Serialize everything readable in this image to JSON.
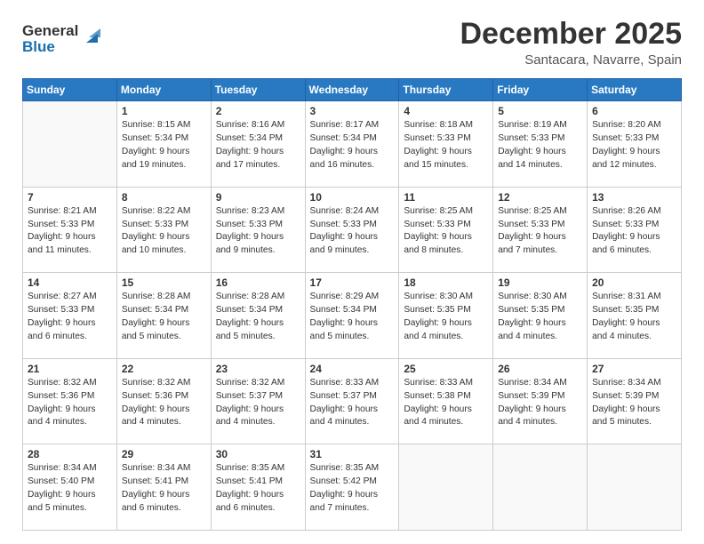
{
  "header": {
    "logo_line1": "General",
    "logo_line2": "Blue",
    "month_title": "December 2025",
    "location": "Santacara, Navarre, Spain"
  },
  "days_of_week": [
    "Sunday",
    "Monday",
    "Tuesday",
    "Wednesday",
    "Thursday",
    "Friday",
    "Saturday"
  ],
  "weeks": [
    [
      {
        "num": "",
        "sunrise": "",
        "sunset": "",
        "daylight": ""
      },
      {
        "num": "1",
        "sunrise": "Sunrise: 8:15 AM",
        "sunset": "Sunset: 5:34 PM",
        "daylight": "Daylight: 9 hours and 19 minutes."
      },
      {
        "num": "2",
        "sunrise": "Sunrise: 8:16 AM",
        "sunset": "Sunset: 5:34 PM",
        "daylight": "Daylight: 9 hours and 17 minutes."
      },
      {
        "num": "3",
        "sunrise": "Sunrise: 8:17 AM",
        "sunset": "Sunset: 5:34 PM",
        "daylight": "Daylight: 9 hours and 16 minutes."
      },
      {
        "num": "4",
        "sunrise": "Sunrise: 8:18 AM",
        "sunset": "Sunset: 5:33 PM",
        "daylight": "Daylight: 9 hours and 15 minutes."
      },
      {
        "num": "5",
        "sunrise": "Sunrise: 8:19 AM",
        "sunset": "Sunset: 5:33 PM",
        "daylight": "Daylight: 9 hours and 14 minutes."
      },
      {
        "num": "6",
        "sunrise": "Sunrise: 8:20 AM",
        "sunset": "Sunset: 5:33 PM",
        "daylight": "Daylight: 9 hours and 12 minutes."
      }
    ],
    [
      {
        "num": "7",
        "sunrise": "Sunrise: 8:21 AM",
        "sunset": "Sunset: 5:33 PM",
        "daylight": "Daylight: 9 hours and 11 minutes."
      },
      {
        "num": "8",
        "sunrise": "Sunrise: 8:22 AM",
        "sunset": "Sunset: 5:33 PM",
        "daylight": "Daylight: 9 hours and 10 minutes."
      },
      {
        "num": "9",
        "sunrise": "Sunrise: 8:23 AM",
        "sunset": "Sunset: 5:33 PM",
        "daylight": "Daylight: 9 hours and 9 minutes."
      },
      {
        "num": "10",
        "sunrise": "Sunrise: 8:24 AM",
        "sunset": "Sunset: 5:33 PM",
        "daylight": "Daylight: 9 hours and 9 minutes."
      },
      {
        "num": "11",
        "sunrise": "Sunrise: 8:25 AM",
        "sunset": "Sunset: 5:33 PM",
        "daylight": "Daylight: 9 hours and 8 minutes."
      },
      {
        "num": "12",
        "sunrise": "Sunrise: 8:25 AM",
        "sunset": "Sunset: 5:33 PM",
        "daylight": "Daylight: 9 hours and 7 minutes."
      },
      {
        "num": "13",
        "sunrise": "Sunrise: 8:26 AM",
        "sunset": "Sunset: 5:33 PM",
        "daylight": "Daylight: 9 hours and 6 minutes."
      }
    ],
    [
      {
        "num": "14",
        "sunrise": "Sunrise: 8:27 AM",
        "sunset": "Sunset: 5:33 PM",
        "daylight": "Daylight: 9 hours and 6 minutes."
      },
      {
        "num": "15",
        "sunrise": "Sunrise: 8:28 AM",
        "sunset": "Sunset: 5:34 PM",
        "daylight": "Daylight: 9 hours and 5 minutes."
      },
      {
        "num": "16",
        "sunrise": "Sunrise: 8:28 AM",
        "sunset": "Sunset: 5:34 PM",
        "daylight": "Daylight: 9 hours and 5 minutes."
      },
      {
        "num": "17",
        "sunrise": "Sunrise: 8:29 AM",
        "sunset": "Sunset: 5:34 PM",
        "daylight": "Daylight: 9 hours and 5 minutes."
      },
      {
        "num": "18",
        "sunrise": "Sunrise: 8:30 AM",
        "sunset": "Sunset: 5:35 PM",
        "daylight": "Daylight: 9 hours and 4 minutes."
      },
      {
        "num": "19",
        "sunrise": "Sunrise: 8:30 AM",
        "sunset": "Sunset: 5:35 PM",
        "daylight": "Daylight: 9 hours and 4 minutes."
      },
      {
        "num": "20",
        "sunrise": "Sunrise: 8:31 AM",
        "sunset": "Sunset: 5:35 PM",
        "daylight": "Daylight: 9 hours and 4 minutes."
      }
    ],
    [
      {
        "num": "21",
        "sunrise": "Sunrise: 8:32 AM",
        "sunset": "Sunset: 5:36 PM",
        "daylight": "Daylight: 9 hours and 4 minutes."
      },
      {
        "num": "22",
        "sunrise": "Sunrise: 8:32 AM",
        "sunset": "Sunset: 5:36 PM",
        "daylight": "Daylight: 9 hours and 4 minutes."
      },
      {
        "num": "23",
        "sunrise": "Sunrise: 8:32 AM",
        "sunset": "Sunset: 5:37 PM",
        "daylight": "Daylight: 9 hours and 4 minutes."
      },
      {
        "num": "24",
        "sunrise": "Sunrise: 8:33 AM",
        "sunset": "Sunset: 5:37 PM",
        "daylight": "Daylight: 9 hours and 4 minutes."
      },
      {
        "num": "25",
        "sunrise": "Sunrise: 8:33 AM",
        "sunset": "Sunset: 5:38 PM",
        "daylight": "Daylight: 9 hours and 4 minutes."
      },
      {
        "num": "26",
        "sunrise": "Sunrise: 8:34 AM",
        "sunset": "Sunset: 5:39 PM",
        "daylight": "Daylight: 9 hours and 4 minutes."
      },
      {
        "num": "27",
        "sunrise": "Sunrise: 8:34 AM",
        "sunset": "Sunset: 5:39 PM",
        "daylight": "Daylight: 9 hours and 5 minutes."
      }
    ],
    [
      {
        "num": "28",
        "sunrise": "Sunrise: 8:34 AM",
        "sunset": "Sunset: 5:40 PM",
        "daylight": "Daylight: 9 hours and 5 minutes."
      },
      {
        "num": "29",
        "sunrise": "Sunrise: 8:34 AM",
        "sunset": "Sunset: 5:41 PM",
        "daylight": "Daylight: 9 hours and 6 minutes."
      },
      {
        "num": "30",
        "sunrise": "Sunrise: 8:35 AM",
        "sunset": "Sunset: 5:41 PM",
        "daylight": "Daylight: 9 hours and 6 minutes."
      },
      {
        "num": "31",
        "sunrise": "Sunrise: 8:35 AM",
        "sunset": "Sunset: 5:42 PM",
        "daylight": "Daylight: 9 hours and 7 minutes."
      },
      {
        "num": "",
        "sunrise": "",
        "sunset": "",
        "daylight": ""
      },
      {
        "num": "",
        "sunrise": "",
        "sunset": "",
        "daylight": ""
      },
      {
        "num": "",
        "sunrise": "",
        "sunset": "",
        "daylight": ""
      }
    ]
  ]
}
